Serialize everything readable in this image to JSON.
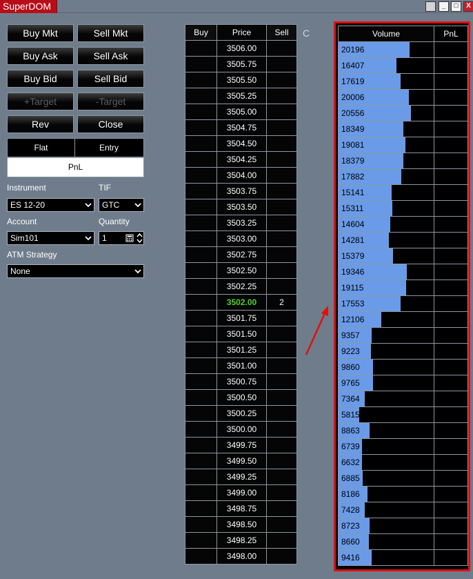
{
  "window": {
    "title": "SuperDOM",
    "controls": {
      "min": "_",
      "max": "□",
      "close": "X"
    }
  },
  "order_buttons": {
    "buy_mkt": "Buy Mkt",
    "sell_mkt": "Sell Mkt",
    "buy_ask": "Buy Ask",
    "sell_ask": "Sell Ask",
    "buy_bid": "Buy Bid",
    "sell_bid": "Sell Bid",
    "plus_target": "+Target",
    "minus_target": "-Target",
    "rev": "Rev",
    "close": "Close"
  },
  "position": {
    "flat": "Flat",
    "entry": "Entry",
    "pnl": "PnL"
  },
  "fields": {
    "instrument_label": "Instrument",
    "instrument_value": "ES 12-20",
    "tif_label": "TIF",
    "tif_value": "GTC",
    "account_label": "Account",
    "account_value": "Sim101",
    "quantity_label": "Quantity",
    "quantity_value": "1",
    "atm_label": "ATM Strategy",
    "atm_value": "None"
  },
  "ladder": {
    "headers": {
      "buy": "Buy",
      "price": "Price",
      "sell": "Sell",
      "c": "C"
    },
    "last_price": "3502.00",
    "rows": [
      {
        "price": "3506.00",
        "sell": ""
      },
      {
        "price": "3505.75",
        "sell": ""
      },
      {
        "price": "3505.50",
        "sell": ""
      },
      {
        "price": "3505.25",
        "sell": ""
      },
      {
        "price": "3505.00",
        "sell": ""
      },
      {
        "price": "3504.75",
        "sell": ""
      },
      {
        "price": "3504.50",
        "sell": ""
      },
      {
        "price": "3504.25",
        "sell": ""
      },
      {
        "price": "3504.00",
        "sell": ""
      },
      {
        "price": "3503.75",
        "sell": ""
      },
      {
        "price": "3503.50",
        "sell": ""
      },
      {
        "price": "3503.25",
        "sell": ""
      },
      {
        "price": "3503.00",
        "sell": ""
      },
      {
        "price": "3502.75",
        "sell": ""
      },
      {
        "price": "3502.50",
        "sell": ""
      },
      {
        "price": "3502.25",
        "sell": ""
      },
      {
        "price": "3502.00",
        "sell": "2"
      },
      {
        "price": "3501.75",
        "sell": ""
      },
      {
        "price": "3501.50",
        "sell": ""
      },
      {
        "price": "3501.25",
        "sell": ""
      },
      {
        "price": "3501.00",
        "sell": ""
      },
      {
        "price": "3500.75",
        "sell": ""
      },
      {
        "price": "3500.50",
        "sell": ""
      },
      {
        "price": "3500.25",
        "sell": ""
      },
      {
        "price": "3500.00",
        "sell": ""
      },
      {
        "price": "3499.75",
        "sell": ""
      },
      {
        "price": "3499.50",
        "sell": ""
      },
      {
        "price": "3499.25",
        "sell": ""
      },
      {
        "price": "3499.00",
        "sell": ""
      },
      {
        "price": "3498.75",
        "sell": ""
      },
      {
        "price": "3498.50",
        "sell": ""
      },
      {
        "price": "3498.25",
        "sell": ""
      },
      {
        "price": "3498.00",
        "sell": ""
      }
    ]
  },
  "volume": {
    "headers": {
      "volume": "Volume",
      "pnl": "PnL"
    },
    "max_volume": 20556,
    "values": [
      "20196",
      "16407",
      "17619",
      "20006",
      "20556",
      "18349",
      "19081",
      "18379",
      "17882",
      "15141",
      "15311",
      "14604",
      "14281",
      "15379",
      "19346",
      "19115",
      "17553",
      "12106",
      "9357",
      "9223",
      "9860",
      "9765",
      "7364",
      "5815",
      "8863",
      "6739",
      "6632",
      "6885",
      "8186",
      "7428",
      "8723",
      "8660",
      "9416"
    ]
  },
  "colors": {
    "accent": "#b80d19",
    "volume_bar": "#6a9be8",
    "last_price": "#4fd12b",
    "highlight_border": "#e01010"
  }
}
